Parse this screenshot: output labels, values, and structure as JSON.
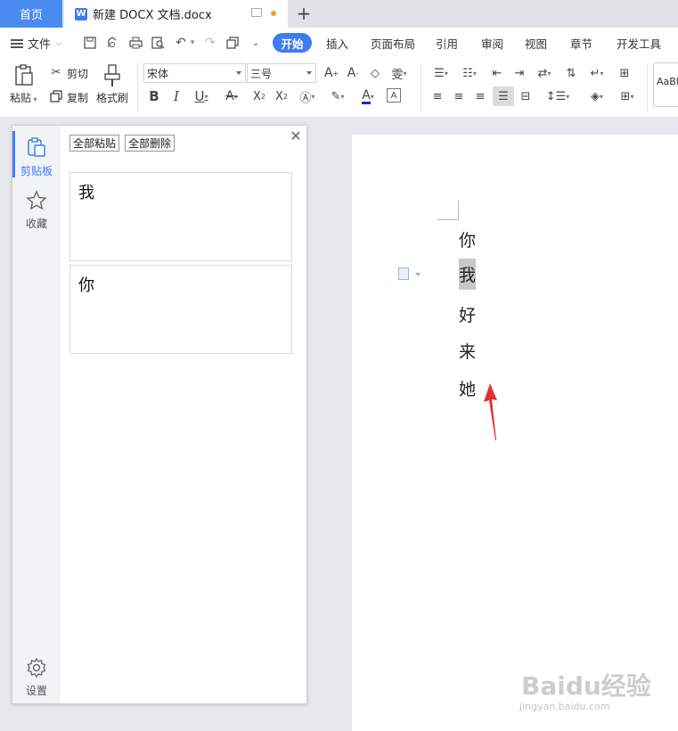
{
  "tabs": {
    "home": "首页",
    "doc_title": "新建 DOCX 文档.docx",
    "doc_icon_letter": "W",
    "add": "+"
  },
  "menu": {
    "file": "文件",
    "items": [
      "开始",
      "插入",
      "页面布局",
      "引用",
      "审阅",
      "视图",
      "章节",
      "开发工具"
    ]
  },
  "ribbon": {
    "paste": "粘贴",
    "cut": "剪切",
    "copy": "复制",
    "format_painter": "格式刷",
    "font_name": "宋体",
    "font_size": "三号",
    "styles_preview": "AaBl"
  },
  "clipboard_panel": {
    "paste_all": "全部粘贴",
    "delete_all": "全部删除",
    "sidebar": [
      {
        "label": "剪贴板",
        "icon": "clipboard-icon",
        "active": true
      },
      {
        "label": "收藏",
        "icon": "star-icon",
        "active": false
      },
      {
        "label": "设置",
        "icon": "gear-icon",
        "active": false
      }
    ],
    "items": [
      "我",
      "你"
    ]
  },
  "document": {
    "lines": [
      "你",
      "我",
      "好",
      "来",
      "她"
    ],
    "selected_index": 1
  },
  "colors": {
    "accent": "#3c7df0",
    "arrow": "#e5312d",
    "selection": "#c8c8c8"
  },
  "watermark": {
    "brand": "Baidu经验",
    "url": "jingyan.baidu.com"
  }
}
